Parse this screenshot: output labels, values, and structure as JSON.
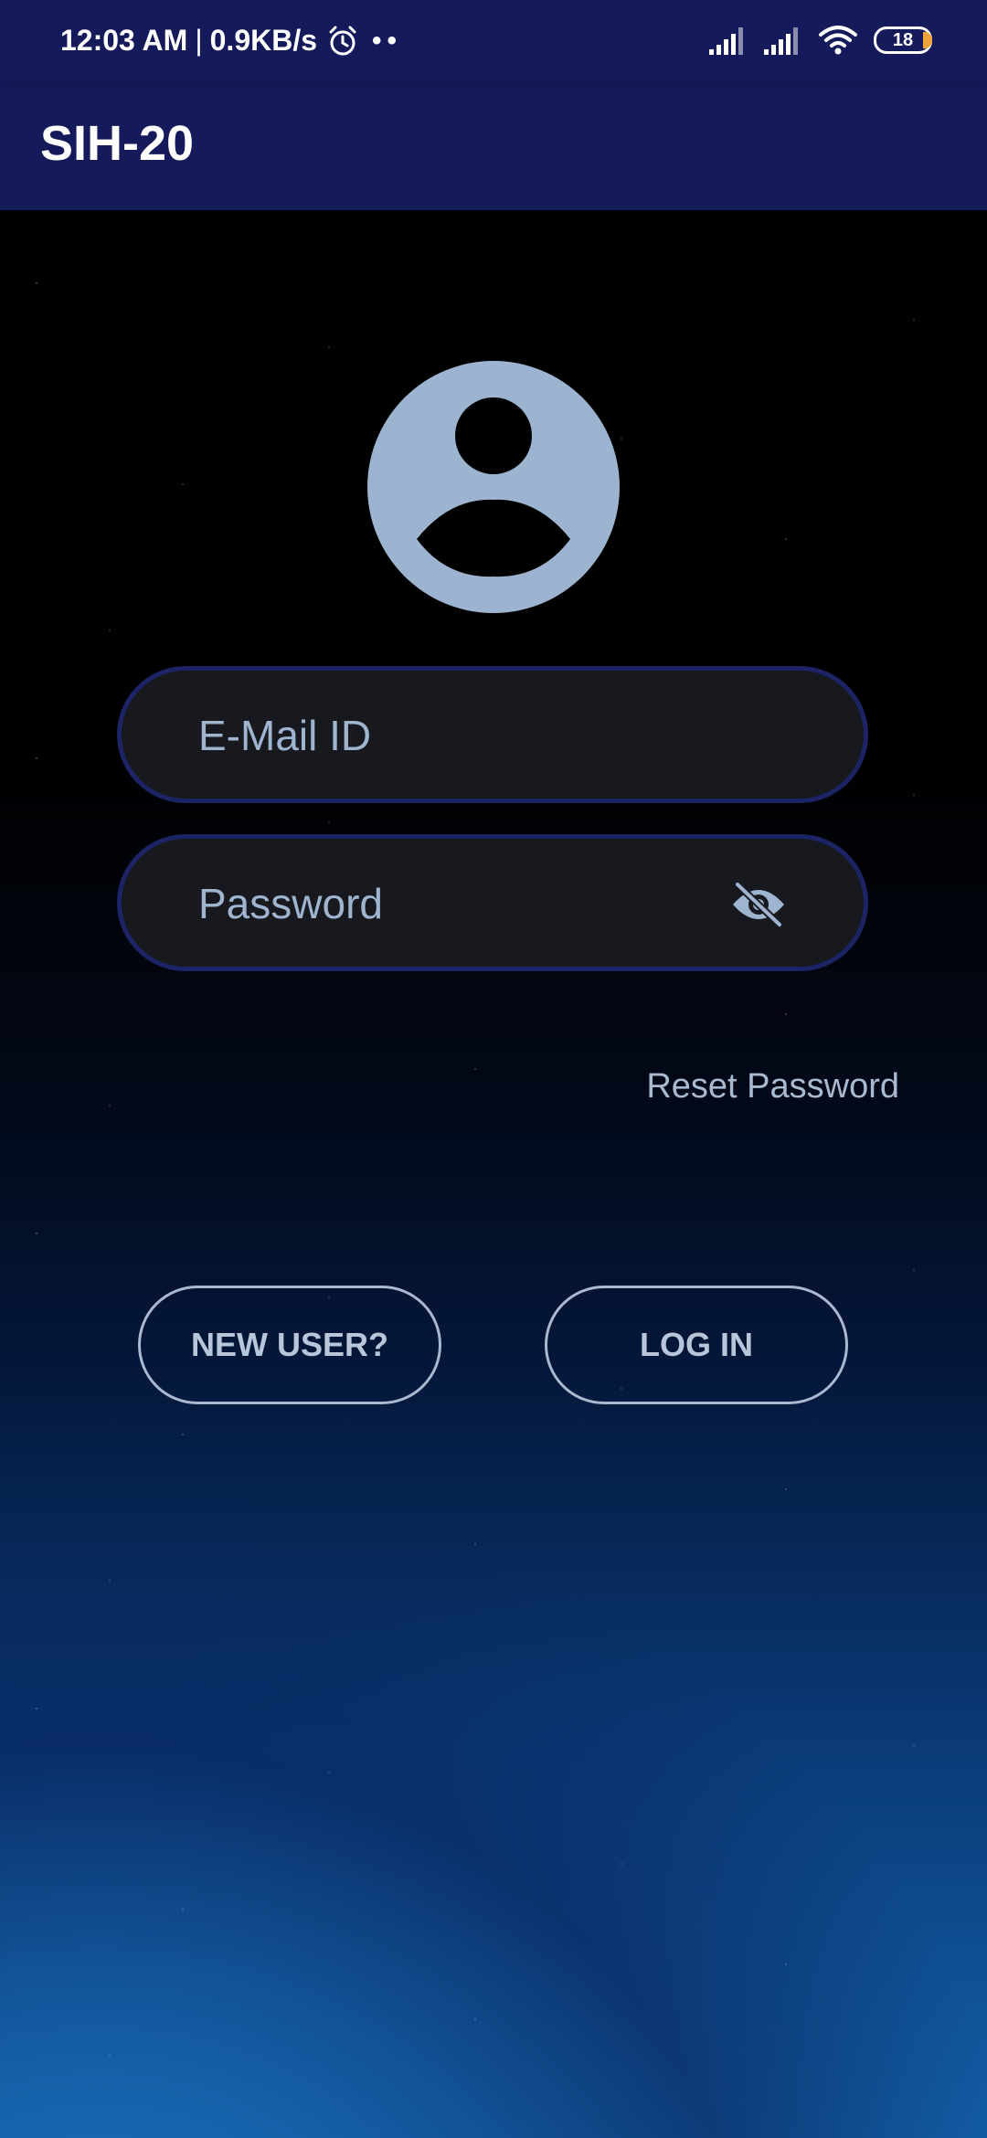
{
  "status_bar": {
    "time": "12:03 AM",
    "separator": "|",
    "network_speed": "0.9KB/s",
    "dots": "••",
    "battery_level": "18",
    "icons": [
      "alarm-icon",
      "signal-icon",
      "signal-icon",
      "wifi-icon",
      "battery-icon"
    ]
  },
  "app_bar": {
    "title": "SIH-20"
  },
  "login": {
    "avatar_icon": "account-circle-icon",
    "email_placeholder": "E-Mail ID",
    "password_placeholder": "Password",
    "password_toggle_icon": "eye-off-icon",
    "reset_password_label": "Reset Password",
    "new_user_label": "NEW USER?",
    "login_label": "LOG IN"
  },
  "colors": {
    "app_bar": "#141a5a",
    "field_bg": "#18191e",
    "field_border": "#1c2466",
    "text_muted": "#9eb4cf",
    "avatar": "#9cb4cf",
    "battery_accent": "#f2a23a"
  }
}
